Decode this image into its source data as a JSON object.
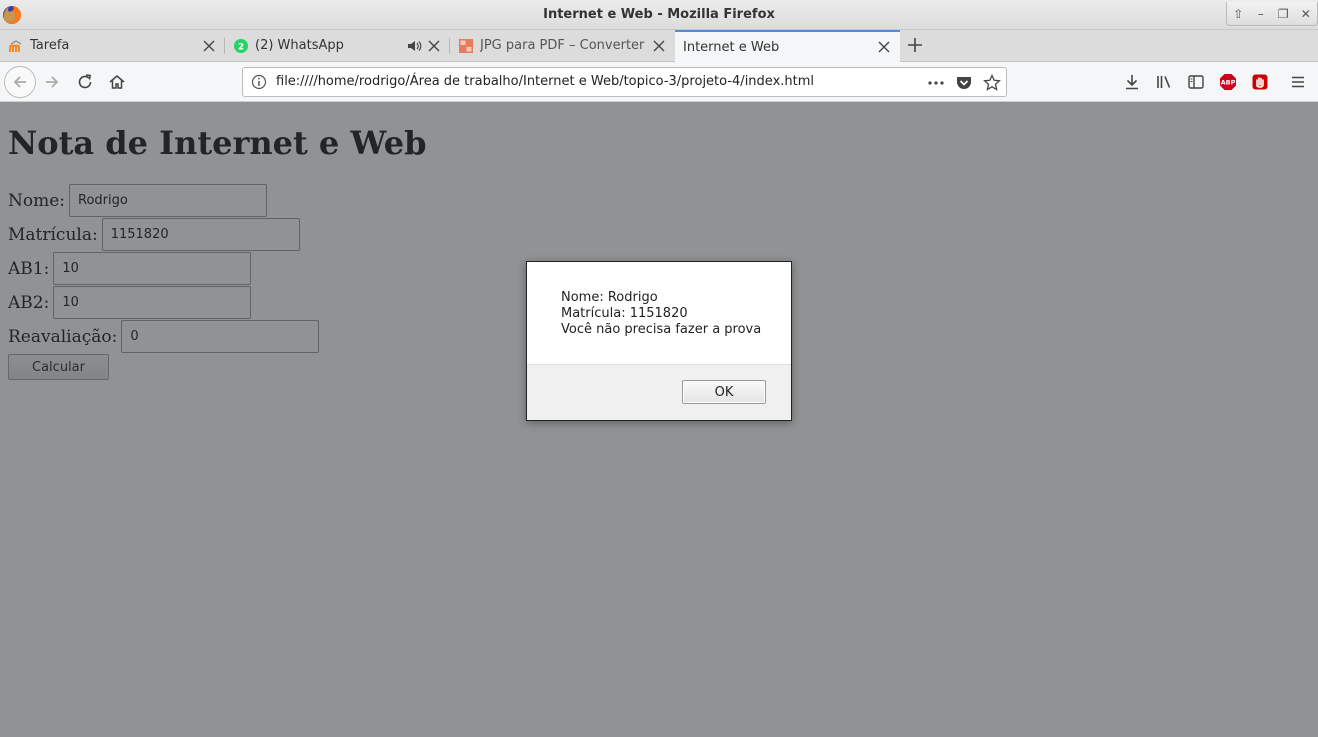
{
  "window": {
    "title": "Internet e Web - Mozilla Firefox"
  },
  "tabs": [
    {
      "label": "Tarefa",
      "active": false,
      "icon": "moodle-icon"
    },
    {
      "label": "(2) WhatsApp",
      "active": false,
      "icon": "whatsapp-icon",
      "badge": "2",
      "playing_audio": true
    },
    {
      "label": "JPG para PDF – Converter",
      "active": false,
      "icon": "jpg-pdf-icon"
    },
    {
      "label": "Internet e Web",
      "active": true
    }
  ],
  "toolbar": {
    "url": "file:////home/rodrigo/Área de trabalho/Internet e Web/topico-3/projeto-4/index.html"
  },
  "page": {
    "heading": "Nota de Internet e Web",
    "fields": {
      "nome": {
        "label": "Nome:",
        "value": "Rodrigo"
      },
      "matricula": {
        "label": "Matrícula:",
        "value": "1151820"
      },
      "ab1": {
        "label": "AB1:",
        "value": "10"
      },
      "ab2": {
        "label": "AB2:",
        "value": "10"
      },
      "reavaliacao": {
        "label": "Reavaliação:",
        "value": "0"
      }
    },
    "calc_label": "Calcular"
  },
  "dialog": {
    "line1": "Nome: Rodrigo",
    "line2": "Matrícula: 1151820",
    "line3": "Você não precisa fazer a prova",
    "ok_label": "OK"
  },
  "colors": {
    "accent": "#4a90d9",
    "abp": "#d0021b",
    "whatsapp": "#25d366"
  }
}
